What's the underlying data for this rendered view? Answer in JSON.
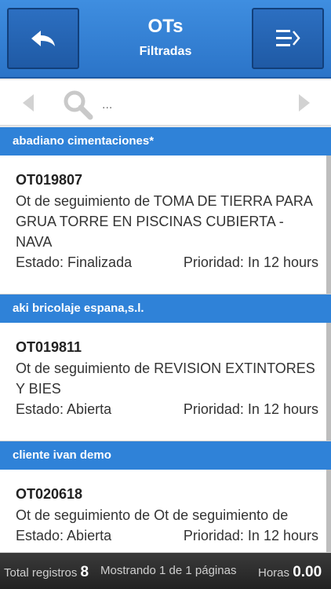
{
  "header": {
    "title": "OTs",
    "subtitle": "Filtradas",
    "back_icon": "back-arrow-icon",
    "menu_icon": "menu-list-icon"
  },
  "search": {
    "placeholder": "...",
    "value": ""
  },
  "groups": [
    {
      "client": "abadiano cimentaciones*",
      "id": "OT019807",
      "description": "Ot de seguimiento de TOMA DE TIERRA PARA GRUA TORRE EN PISCINAS CUBIERTA - NAVA",
      "status": "Estado: Finalizada",
      "priority": "Prioridad: In 12 hours"
    },
    {
      "client": "aki bricolaje espana,s.l.",
      "id": "OT019811",
      "description": "Ot de seguimiento de REVISION EXTINTORES Y BIES",
      "status": "Estado: Abierta",
      "priority": "Prioridad: In 12 hours"
    },
    {
      "client": "cliente ivan demo",
      "id": "OT020618",
      "description": "Ot de seguimiento de Ot de seguimiento de",
      "status": "Estado: Abierta",
      "priority": "Prioridad: In 12 hours"
    }
  ],
  "footer": {
    "total_label": "Total registros",
    "total_value": "8",
    "paging": "Mostrando 1 de 1 páginas",
    "hours_label": "Horas",
    "hours_value": "0.00"
  },
  "colors": {
    "header": "#3f8ee0",
    "group_header": "#2f82d8",
    "footer": "#2b2b2b"
  }
}
